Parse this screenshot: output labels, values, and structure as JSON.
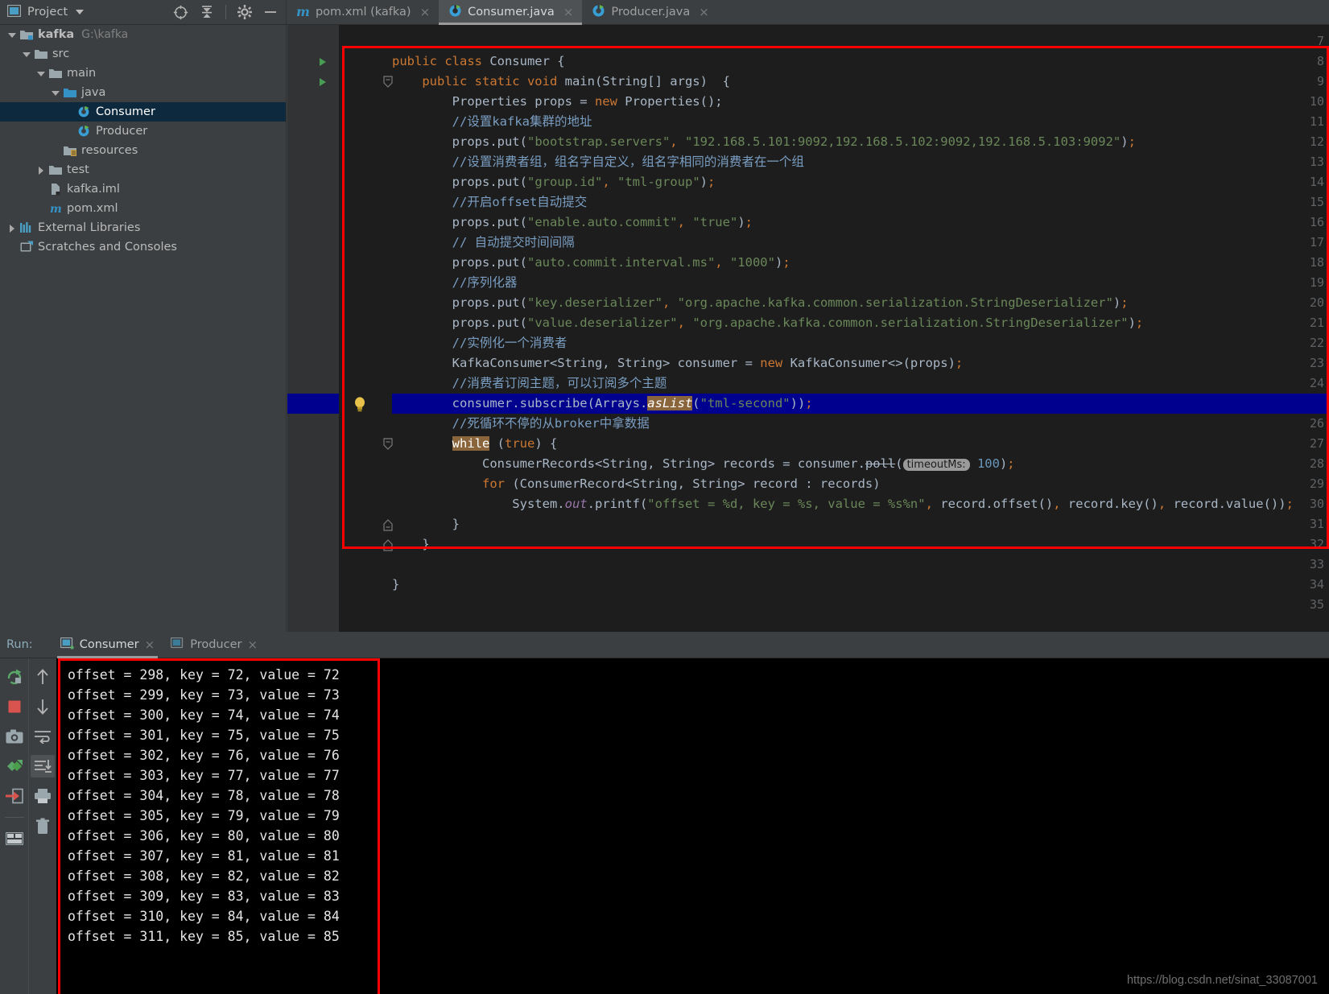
{
  "window": {
    "project_panel_label": "Project",
    "toolbar_icons": [
      "locate-icon",
      "collapse-all-icon",
      "gear-icon",
      "minimize-icon"
    ]
  },
  "tabs": [
    {
      "label": "pom.xml (kafka)",
      "icon": "maven-m-icon",
      "active": false,
      "close": "×"
    },
    {
      "label": "Consumer.java",
      "icon": "java-class-icon",
      "active": true,
      "close": "×"
    },
    {
      "label": "Producer.java",
      "icon": "java-class-icon",
      "active": false,
      "close": "×"
    }
  ],
  "tree": [
    {
      "label": "kafka",
      "path": "G:\\kafka",
      "indent": 0,
      "arrow": "down",
      "icon": "module-folder-icon",
      "bold": true,
      "selected": false
    },
    {
      "label": "src",
      "path": "",
      "indent": 1,
      "arrow": "down",
      "icon": "folder-icon",
      "bold": false,
      "selected": false
    },
    {
      "label": "main",
      "path": "",
      "indent": 2,
      "arrow": "down",
      "icon": "folder-icon",
      "bold": false,
      "selected": false
    },
    {
      "label": "java",
      "path": "",
      "indent": 3,
      "arrow": "down",
      "icon": "source-folder-icon",
      "bold": false,
      "selected": false
    },
    {
      "label": "Consumer",
      "path": "",
      "indent": 4,
      "arrow": "none",
      "icon": "java-class-icon",
      "bold": false,
      "selected": true
    },
    {
      "label": "Producer",
      "path": "",
      "indent": 4,
      "arrow": "none",
      "icon": "java-class-icon",
      "bold": false,
      "selected": false
    },
    {
      "label": "resources",
      "path": "",
      "indent": 3,
      "arrow": "none",
      "icon": "resources-folder-icon",
      "bold": false,
      "selected": false
    },
    {
      "label": "test",
      "path": "",
      "indent": 2,
      "arrow": "right",
      "icon": "folder-icon",
      "bold": false,
      "selected": false
    },
    {
      "label": "kafka.iml",
      "path": "",
      "indent": 2,
      "arrow": "none",
      "icon": "iml-file-icon",
      "bold": false,
      "selected": false
    },
    {
      "label": "pom.xml",
      "path": "",
      "indent": 2,
      "arrow": "none",
      "icon": "maven-m-icon",
      "bold": false,
      "selected": false
    },
    {
      "label": "External Libraries",
      "path": "",
      "indent": 0,
      "arrow": "right",
      "icon": "libraries-icon",
      "bold": false,
      "selected": false
    },
    {
      "label": "Scratches and Consoles",
      "path": "",
      "indent": 0,
      "arrow": "none",
      "icon": "scratches-icon",
      "bold": false,
      "selected": false
    }
  ],
  "editor": {
    "first_line_number": 7,
    "last_line_number": 35,
    "current_line": 25,
    "run_marker_lines": [
      8,
      9
    ],
    "fold_lines": [
      9,
      27,
      31,
      32
    ],
    "bulb_line": 25,
    "lines": [
      {
        "n": 7,
        "html": ""
      },
      {
        "n": 8,
        "html": "<span class=\"kw\">public class</span> Consumer {"
      },
      {
        "n": 9,
        "html": "    <span class=\"kw\">public static void</span> main(String[] args)  {"
      },
      {
        "n": 10,
        "html": "        Properties props = <span class=\"kw\">new</span> Properties();"
      },
      {
        "n": 11,
        "html": "        <span class=\"cmt-i\">//设置kafka集群的地址</span>"
      },
      {
        "n": 12,
        "html": "        props.put(<span class=\"str\">\"bootstrap.servers\"</span><span class=\"kw\">,</span> <span class=\"str\">\"192.168.5.101:9092,192.168.5.102:9092,192.168.5.103:9092\"</span>)<span class=\"kw\">;</span>"
      },
      {
        "n": 13,
        "html": "        <span class=\"cmt-i\">//设置消费者组，组名字自定义，组名字相同的消费者在一个组</span>"
      },
      {
        "n": 14,
        "html": "        props.put(<span class=\"str\">\"group.id\"</span><span class=\"kw\">,</span> <span class=\"str\">\"tml-group\"</span>)<span class=\"kw\">;</span>"
      },
      {
        "n": 15,
        "html": "        <span class=\"cmt-i\">//开启offset自动提交</span>"
      },
      {
        "n": 16,
        "html": "        props.put(<span class=\"str\">\"enable.auto.commit\"</span><span class=\"kw\">,</span> <span class=\"str\">\"true\"</span>)<span class=\"kw\">;</span>"
      },
      {
        "n": 17,
        "html": "        <span class=\"cmt-i\">// 自动提交时间间隔</span>"
      },
      {
        "n": 18,
        "html": "        props.put(<span class=\"str\">\"auto.commit.interval.ms\"</span><span class=\"kw\">,</span> <span class=\"str\">\"1000\"</span>)<span class=\"kw\">;</span>"
      },
      {
        "n": 19,
        "html": "        <span class=\"cmt-i\">//序列化器</span>"
      },
      {
        "n": 20,
        "html": "        props.put(<span class=\"str\">\"key.deserializer\"</span><span class=\"kw\">,</span> <span class=\"str\">\"org.apache.kafka.common.serialization.StringDeserializer\"</span>)<span class=\"kw\">;</span>"
      },
      {
        "n": 21,
        "html": "        props.put(<span class=\"str\">\"value.deserializer\"</span><span class=\"kw\">,</span> <span class=\"str\">\"org.apache.kafka.common.serialization.StringDeserializer\"</span>)<span class=\"kw\">;</span>"
      },
      {
        "n": 22,
        "html": "        <span class=\"cmt-i\">//实例化一个消费者</span>"
      },
      {
        "n": 23,
        "html": "        KafkaConsumer&lt;String, String&gt; consumer = <span class=\"kw\">new</span> KafkaConsumer&lt;&gt;(props)<span class=\"kw\">;</span>"
      },
      {
        "n": 24,
        "html": "        <span class=\"cmt-i\">//消费者订阅主题，可以订阅多个主题</span>"
      },
      {
        "n": 25,
        "html": "        consumer.subscribe(Arrays.<span class=\"stat-hl\"><i>asList</i></span>(<span class=\"str\">\"tml-second\"</span>))<span class=\"kw\">;</span>"
      },
      {
        "n": 26,
        "html": "        <span class=\"cmt-i\">//死循环不停的从broker中拿数据</span>"
      },
      {
        "n": 27,
        "html": "        <span class=\"stat-hl\">while</span> (<span class=\"kw\">true</span>) {"
      },
      {
        "n": 28,
        "html": "            ConsumerRecords&lt;String, String&gt; records = consumer.<span class=\"deprecated\">poll</span>(<span class=\"hint\">timeoutMs:</span> <span class=\"num\">100</span>)<span class=\"kw\">;</span>"
      },
      {
        "n": 29,
        "html": "            <span class=\"kw\">for</span> (ConsumerRecord&lt;String, String&gt; record : records)"
      },
      {
        "n": 30,
        "html": "                System.<span class=\"fld\">out</span>.printf(<span class=\"str\">\"offset = %d, key = %s, value = %s%n\"</span><span class=\"kw\">,</span> record.offset()<span class=\"kw\">,</span> record.key()<span class=\"kw\">,</span> record.value())<span class=\"kw\">;</span>"
      },
      {
        "n": 31,
        "html": "        }"
      },
      {
        "n": 32,
        "html": "    }"
      },
      {
        "n": 33,
        "html": ""
      },
      {
        "n": 34,
        "html": "}"
      },
      {
        "n": 35,
        "html": ""
      }
    ]
  },
  "run_panel": {
    "run_label": "Run:",
    "tabs": [
      {
        "label": "Consumer",
        "active": true,
        "running": true,
        "close": "×"
      },
      {
        "label": "Producer",
        "active": false,
        "running": false,
        "close": "×"
      }
    ],
    "toolbar_left": [
      "rerun-icon",
      "stop-icon",
      "screenshot-icon",
      "threaddump-icon",
      "export-icon",
      "layout-icon"
    ],
    "toolbar_right": [
      "up-arrow-icon",
      "down-arrow-icon",
      "soft-wrap-icon",
      "scroll-to-end-icon",
      "print-icon",
      "trash-icon"
    ],
    "console_lines": [
      "offset = 298, key = 72, value = 72",
      "offset = 299, key = 73, value = 73",
      "offset = 300, key = 74, value = 74",
      "offset = 301, key = 75, value = 75",
      "offset = 302, key = 76, value = 76",
      "offset = 303, key = 77, value = 77",
      "offset = 304, key = 78, value = 78",
      "offset = 305, key = 79, value = 79",
      "offset = 306, key = 80, value = 80",
      "offset = 307, key = 81, value = 81",
      "offset = 308, key = 82, value = 82",
      "offset = 309, key = 83, value = 83",
      "offset = 310, key = 84, value = 84",
      "offset = 311, key = 85, value = 85"
    ],
    "watermark": "https://blog.csdn.net/sinat_33087001"
  },
  "annotations": {
    "accent_red": "#ff0000",
    "editor_box_label": "code-highlight-box",
    "console_box_label": "console-highlight-box"
  }
}
